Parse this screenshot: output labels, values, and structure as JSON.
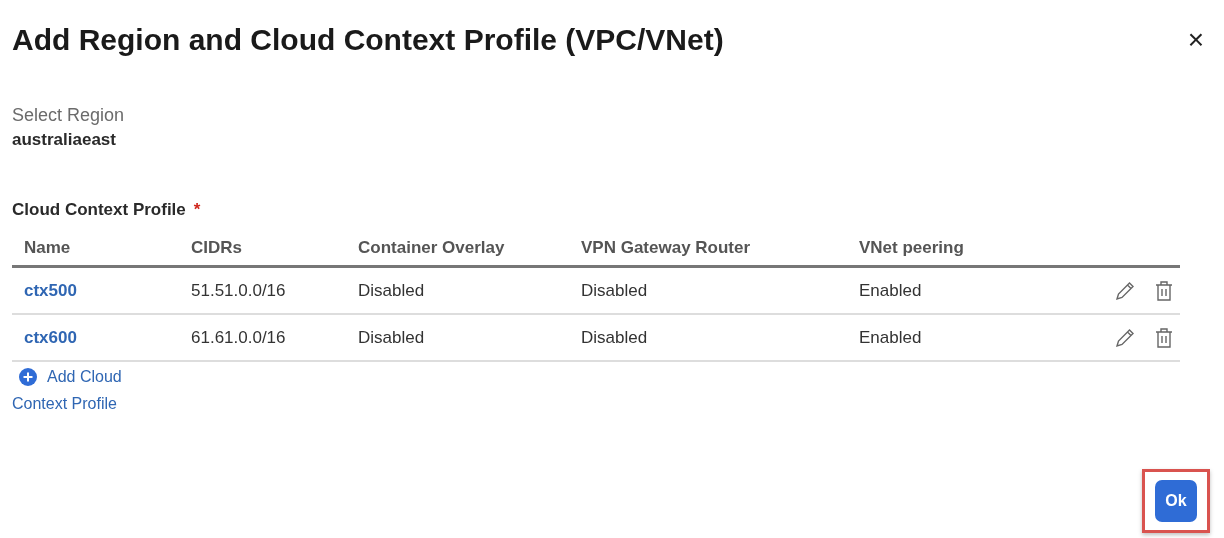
{
  "dialog": {
    "title": "Add Region and Cloud Context Profile (VPC/VNet)",
    "close": "×"
  },
  "region": {
    "label": "Select Region",
    "value": "australiaeast"
  },
  "profile_section": {
    "label": "Cloud Context Profile",
    "required": true,
    "required_mark": "*"
  },
  "table": {
    "columns": [
      "Name",
      "CIDRs",
      "Container Overlay",
      "VPN Gateway Router",
      "VNet peering"
    ],
    "rows": [
      {
        "name": "ctx500",
        "cidrs": "51.51.0.0/16",
        "container_overlay": "Disabled",
        "vpn_gateway_router": "Disabled",
        "vnet_peering": "Enabled"
      },
      {
        "name": "ctx600",
        "cidrs": "61.61.0.0/16",
        "container_overlay": "Disabled",
        "vpn_gateway_router": "Disabled",
        "vnet_peering": "Enabled"
      }
    ]
  },
  "add_link": {
    "lines": [
      "Add Cloud",
      "Context Profile"
    ]
  },
  "ok_button": {
    "label": "Ok",
    "highlighted": true
  }
}
